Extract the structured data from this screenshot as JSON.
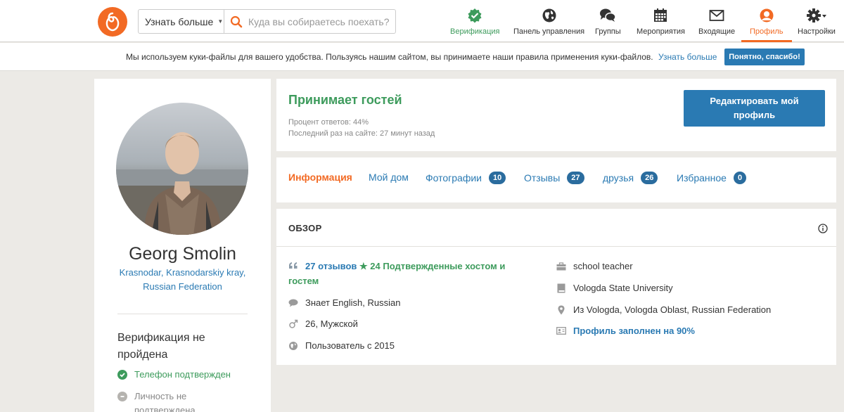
{
  "header": {
    "logo": "couchsurfing-logo",
    "search_dropdown": "Узнать больше",
    "search_placeholder": "Куда вы собираетесь поехать?",
    "nav": [
      {
        "label": "Верификация",
        "icon": "check-badge-icon"
      },
      {
        "label": "Панель управления",
        "icon": "globe-icon"
      },
      {
        "label": "Группы",
        "icon": "chat-bubbles-icon"
      },
      {
        "label": "Мероприятия",
        "icon": "calendar-icon"
      },
      {
        "label": "Входящие",
        "icon": "envelope-icon"
      },
      {
        "label": "Профиль",
        "icon": "user-icon"
      },
      {
        "label": "Настройки",
        "icon": "gear-icon"
      }
    ]
  },
  "cookie": {
    "text": "Мы используем куки-файлы для вашего удобства. Пользуясь нашим сайтом, вы принимаете наши правила применения куки-файлов.",
    "link": "Узнать больше",
    "button": "Понятно, спасибо!"
  },
  "profile": {
    "name": "Georg Smolin",
    "location": "Krasnodar, Krasnodarskiy kray, Russian Federation",
    "verification_title": "Верификация не пройдена",
    "verification_items": [
      {
        "label": "Телефон подтвержден",
        "status": "verified"
      },
      {
        "label": "Личность не подтверждена",
        "status": "not-verified"
      }
    ]
  },
  "status": {
    "title": "Принимает гостей",
    "response_rate": "Процент ответов: 44%",
    "last_seen": "Последний раз на сайте: 27 минут назад",
    "edit_button": "Редактировать мой профиль"
  },
  "tabs": [
    {
      "label": "Информация",
      "count": null,
      "active": true
    },
    {
      "label": "Мой дом",
      "count": null,
      "active": false
    },
    {
      "label": "Фотографии",
      "count": "10",
      "active": false
    },
    {
      "label": "Отзывы",
      "count": "27",
      "active": false
    },
    {
      "label": "друзья",
      "count": "26",
      "active": false
    },
    {
      "label": "Избранное",
      "count": "0",
      "active": false
    }
  ],
  "overview": {
    "title": "ОБЗОР",
    "references": "27 отзывов",
    "confirmed": "24 Подтвержденные хостом и гостем",
    "languages": "Знает English, Russian",
    "age_gender": "26, Мужской",
    "member_since": "Пользователь с 2015",
    "occupation": "school teacher",
    "education": "Vologda State University",
    "hometown": "Из Vologda, Vologda Oblast, Russian Federation",
    "completeness": "Профиль заполнен на 90%"
  },
  "colors": {
    "accent": "#f26a24",
    "link": "#2a7ab3",
    "success": "#3d9b5c",
    "badge": "#2a6c9e",
    "background": "#eceae6"
  }
}
